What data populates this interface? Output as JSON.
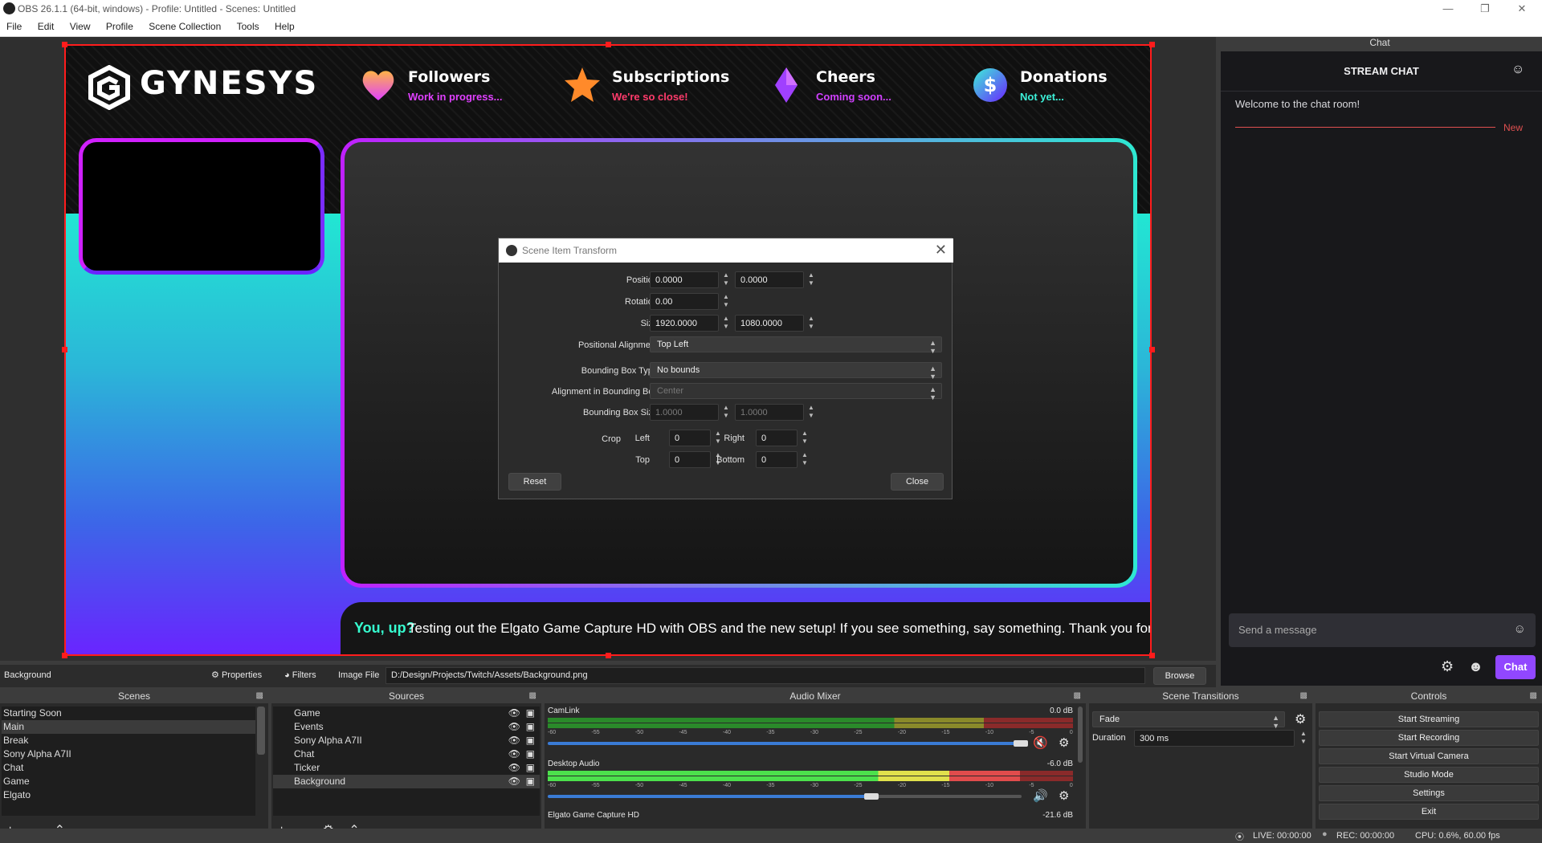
{
  "window": {
    "title": "OBS 26.1.1 (64-bit, windows) - Profile: Untitled - Scenes: Untitled"
  },
  "menu": [
    "File",
    "Edit",
    "View",
    "Profile",
    "Scene Collection",
    "Tools",
    "Help"
  ],
  "overlay": {
    "logo": "GYNESYS",
    "stats": [
      {
        "name": "Followers",
        "sub": "Work in progress...",
        "color": "#e040ff"
      },
      {
        "name": "Subscriptions",
        "sub": "We're so close!",
        "color": "#ff3b6b"
      },
      {
        "name": "Cheers",
        "sub": "Coming soon...",
        "color": "#d040ff"
      },
      {
        "name": "Donations",
        "sub": "Not yet...",
        "color": "#3cf0d8"
      }
    ],
    "ticker_highlight": "You, up?",
    "ticker_text": "Testing out the Elgato Game Capture HD with OBS and the new setup! If you see something, say something. Thank you for riding with MTA!"
  },
  "dialog": {
    "title": "Scene Item Transform",
    "position_label": "Position",
    "position_x": "0.0000",
    "position_y": "0.0000",
    "rotation_label": "Rotation",
    "rotation": "0.00",
    "size_label": "Size",
    "size_w": "1920.0000",
    "size_h": "1080.0000",
    "alignment_label": "Positional Alignment",
    "alignment": "Top Left",
    "bbox_type_label": "Bounding Box Type",
    "bbox_type": "No bounds",
    "bbox_align_label": "Alignment in Bounding Box",
    "bbox_align": "Center",
    "bbox_size_label": "Bounding Box Size",
    "bbox_w": "1.0000",
    "bbox_h": "1.0000",
    "crop_label": "Crop",
    "left_label": "Left",
    "crop_left": "0",
    "right_label": "Right",
    "crop_right": "0",
    "top_label": "Top",
    "crop_top": "0",
    "bottom_label": "Bottom",
    "crop_bottom": "0",
    "reset": "Reset",
    "close": "Close"
  },
  "chat": {
    "dock_title": "Chat",
    "header": "STREAM CHAT",
    "welcome": "Welcome to the chat room!",
    "new_label": "New",
    "placeholder": "Send a message",
    "chat_button": "Chat"
  },
  "source_bar": {
    "selected": "Background",
    "properties": "Properties",
    "filters": "Filters",
    "file_label": "Image File",
    "file_path": "D:/Design/Projects/Twitch/Assets/Background.png",
    "browse": "Browse"
  },
  "scenes": {
    "title": "Scenes",
    "items": [
      "Starting Soon",
      "Main",
      "Break",
      "Sony Alpha A7II",
      "Chat",
      "Game",
      "Elgato"
    ],
    "selected_index": 1
  },
  "sources": {
    "title": "Sources",
    "items": [
      "Game",
      "Events",
      "Sony Alpha A7II",
      "Chat",
      "Ticker",
      "Background"
    ],
    "selected_index": 5
  },
  "mixer": {
    "title": "Audio Mixer",
    "channels": [
      {
        "name": "CamLink",
        "db": "0.0 dB",
        "level": 0,
        "volume": 1.0,
        "muted": true
      },
      {
        "name": "Desktop Audio",
        "db": "-6.0 dB",
        "level": 0.9,
        "volume": 0.68,
        "muted": false
      },
      {
        "name": "Elgato Game Capture HD",
        "db": "-21.6 dB"
      }
    ],
    "scale": [
      "-60",
      "-55",
      "-50",
      "-45",
      "-40",
      "-35",
      "-30",
      "-25",
      "-20",
      "-15",
      "-10",
      "-5",
      "0"
    ]
  },
  "transitions": {
    "title": "Scene Transitions",
    "selected": "Fade",
    "duration_label": "Duration",
    "duration": "300 ms"
  },
  "controls": {
    "title": "Controls",
    "buttons": [
      "Start Streaming",
      "Start Recording",
      "Start Virtual Camera",
      "Studio Mode",
      "Settings",
      "Exit"
    ]
  },
  "status": {
    "live": "LIVE: 00:00:00",
    "rec": "REC: 00:00:00",
    "cpu": "CPU: 0.6%, 60.00 fps"
  }
}
